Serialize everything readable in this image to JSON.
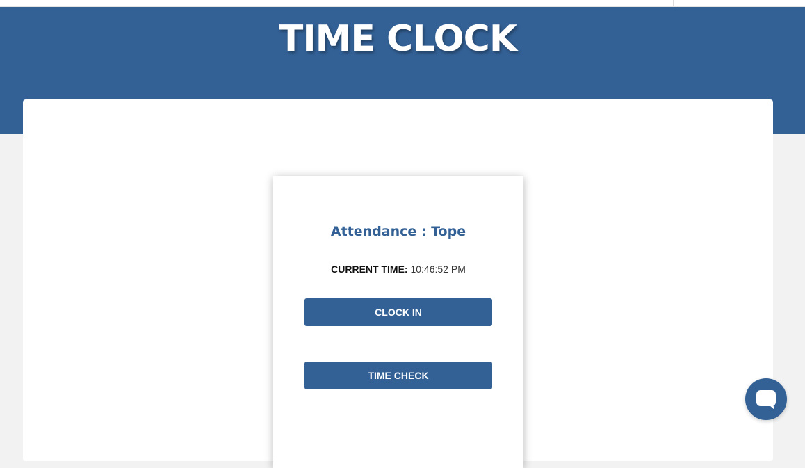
{
  "header": {
    "title": "TIME CLOCK"
  },
  "card": {
    "heading": "Attendance : Tope",
    "current_time_label": "CURRENT TIME:",
    "current_time_value": "10:46:52 PM",
    "clock_in_label": "CLOCK IN",
    "time_check_label": "TIME CHECK"
  },
  "chat": {
    "icon": "chat-icon"
  },
  "colors": {
    "brand": "#336196",
    "background": "#f2f2f2",
    "panel": "#ffffff"
  }
}
